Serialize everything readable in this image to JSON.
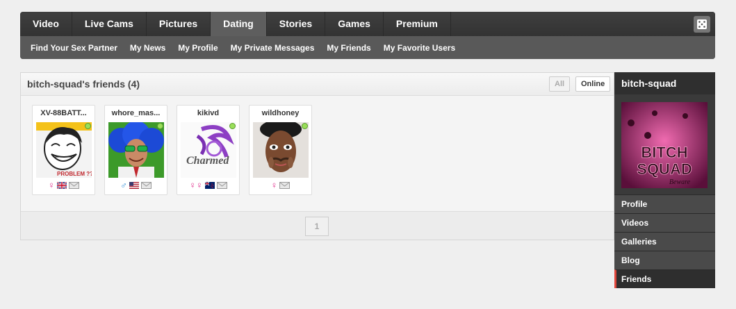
{
  "nav": {
    "tabs": [
      {
        "label": "Video"
      },
      {
        "label": "Live Cams"
      },
      {
        "label": "Pictures"
      },
      {
        "label": "Dating",
        "active": true
      },
      {
        "label": "Stories"
      },
      {
        "label": "Games"
      },
      {
        "label": "Premium"
      }
    ],
    "sub": [
      {
        "label": "Find Your Sex Partner"
      },
      {
        "label": "My News"
      },
      {
        "label": "My Profile"
      },
      {
        "label": "My Private Messages"
      },
      {
        "label": "My Friends"
      },
      {
        "label": "My Favorite Users"
      }
    ],
    "random_icon": "dice-icon"
  },
  "panel": {
    "title": "bitch-squad's friends (4)",
    "filters": {
      "all": "All",
      "online": "Online"
    },
    "pagination": {
      "current_page": "1"
    }
  },
  "friends": [
    {
      "name": "XV-88BATT...",
      "gender": "female",
      "gender_symbol": "♀",
      "flag": "uk-flag-icon",
      "online": true,
      "avatar": "troll-face-avatar",
      "avatar_caption": "PROBLEM ??"
    },
    {
      "name": "whore_mas...",
      "gender": "male",
      "gender_symbol": "♂",
      "flag": "us-flag-icon",
      "online": true,
      "avatar": "blue-wig-avatar"
    },
    {
      "name": "kikivd",
      "gender": "couple",
      "gender_symbol": "♀♀",
      "flag": "nz-flag-icon",
      "online": true,
      "avatar": "charmed-logo-avatar",
      "avatar_caption": "Charmed"
    },
    {
      "name": "wildhoney",
      "gender": "female",
      "gender_symbol": "♀",
      "online": true,
      "avatar": "woman-portrait-avatar"
    }
  ],
  "sidebar": {
    "username": "bitch-squad",
    "avatar_text": [
      "BITCH",
      "SQUAD",
      "Beware"
    ],
    "menu": [
      {
        "label": "Profile"
      },
      {
        "label": "Videos"
      },
      {
        "label": "Galleries"
      },
      {
        "label": "Blog"
      },
      {
        "label": "Friends",
        "active": true
      }
    ]
  },
  "colors": {
    "female": "#e0338f",
    "male": "#2a8ad6",
    "online": "#9adf5a",
    "active_marker": "#e0463b"
  }
}
